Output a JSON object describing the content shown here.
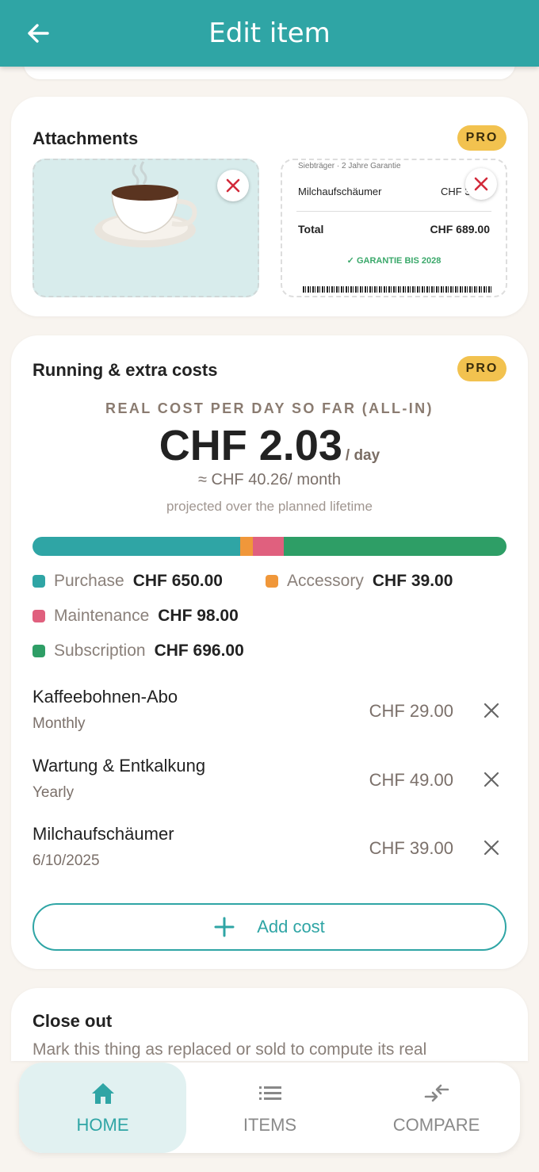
{
  "appbar": {
    "title": "Edit item"
  },
  "attachments": {
    "title": "Attachments",
    "badge": "PRO",
    "receipt": {
      "small_text": "Siebträger · 2 Jahre Garantie",
      "line_item": "Milchaufschäumer",
      "line_value": "CHF 3",
      "total_label": "Total",
      "total_value": "CHF 689.00",
      "guarantee": "✓ GARANTIE BIS 2028"
    }
  },
  "running": {
    "title": "Running & extra costs",
    "badge": "PRO",
    "eyebrow": "REAL COST PER DAY SO FAR (ALL-IN)",
    "per_day": "CHF 2.03",
    "per_day_unit": "/ day",
    "per_month": "≈ CHF 40.26/ month",
    "projection_note": "projected over the planned lifetime",
    "breakdown": [
      {
        "label": "Purchase",
        "value": "CHF 650.00",
        "amount": 650,
        "color": "#2fa5a5"
      },
      {
        "label": "Accessory",
        "value": "CHF 39.00",
        "amount": 39,
        "color": "#f0973a"
      },
      {
        "label": "Maintenance",
        "value": "CHF 98.00",
        "amount": 98,
        "color": "#e0607e"
      },
      {
        "label": "Subscription",
        "value": "CHF 696.00",
        "amount": 696,
        "color": "#2e9e66"
      }
    ],
    "costs": [
      {
        "name": "Kaffeebohnen-Abo",
        "freq": "Monthly",
        "amount": "CHF 29.00"
      },
      {
        "name": "Wartung & Entkalkung",
        "freq": "Yearly",
        "amount": "CHF 49.00"
      },
      {
        "name": "Milchaufschäumer",
        "freq": "6/10/2025",
        "amount": "CHF 39.00"
      }
    ],
    "add_label": "Add cost"
  },
  "closeout": {
    "title": "Close out",
    "text": "Mark this thing as replaced or sold to compute its real"
  },
  "nav": {
    "tabs": [
      {
        "label": "HOME",
        "icon": "home-icon"
      },
      {
        "label": "ITEMS",
        "icon": "list-icon"
      },
      {
        "label": "COMPARE",
        "icon": "compare-icon"
      }
    ]
  }
}
